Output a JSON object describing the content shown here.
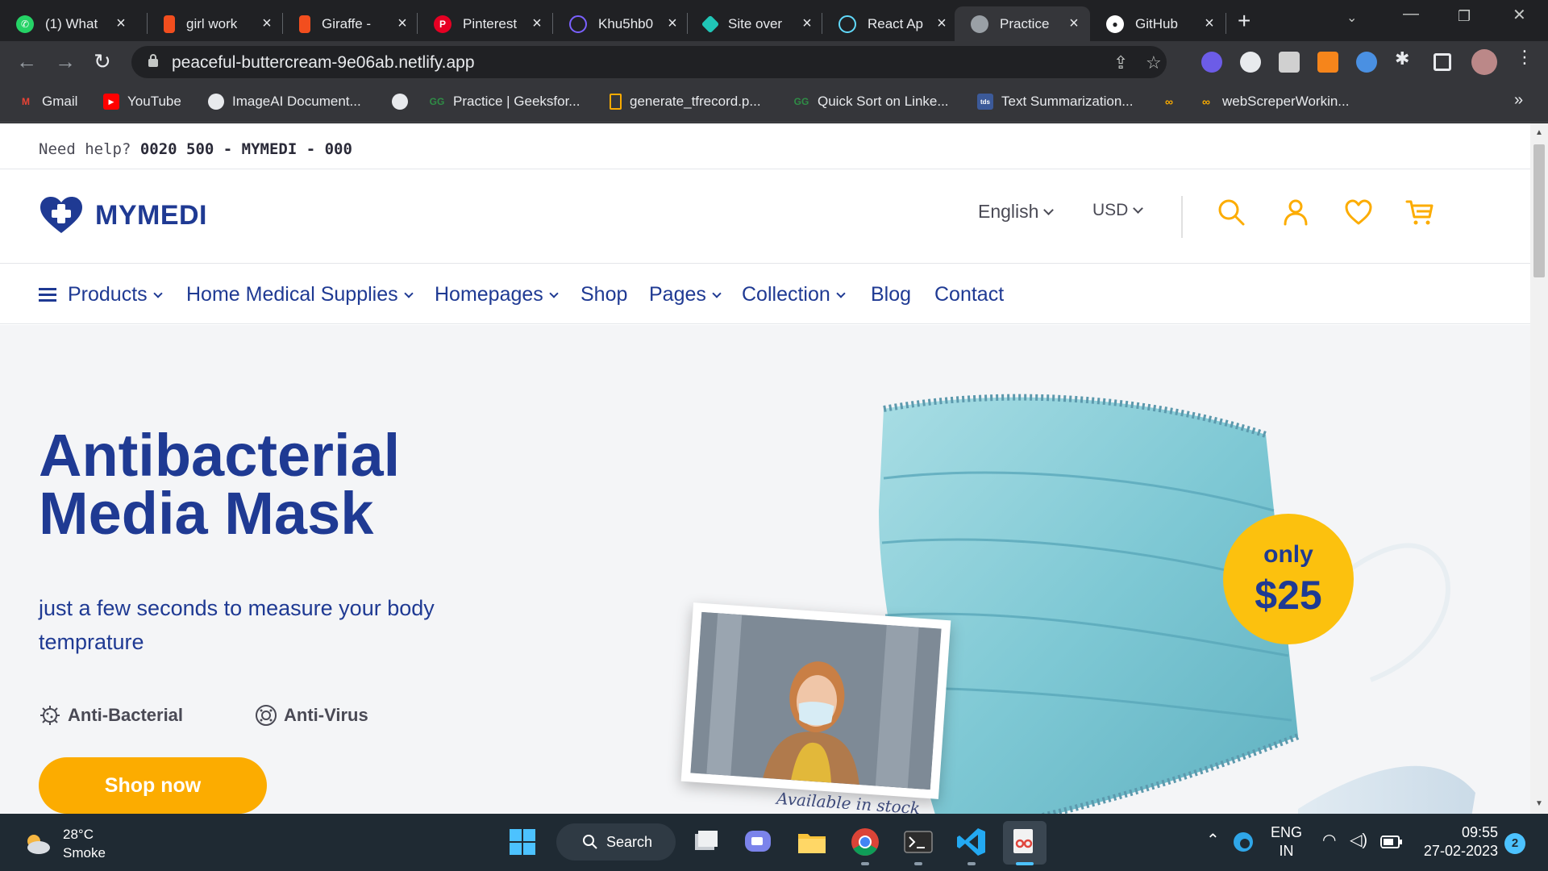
{
  "browser": {
    "tabs": [
      {
        "label": "(1) What",
        "icon": "whatsapp-icon",
        "color": "#25d366"
      },
      {
        "label": "girl work",
        "icon": "figma-icon",
        "color": "#f24e1e"
      },
      {
        "label": "Giraffe -",
        "icon": "figma-icon",
        "color": "#f24e1e"
      },
      {
        "label": "Pinterest",
        "icon": "pinterest-icon",
        "color": "#e60023"
      },
      {
        "label": "Khu5hb0",
        "icon": "web-icon",
        "color": "#7b61ff"
      },
      {
        "label": "Site over",
        "icon": "netlify-icon",
        "color": "#20c6b7"
      },
      {
        "label": "React Ap",
        "icon": "react-icon",
        "color": "#61dafb"
      },
      {
        "label": "Practice",
        "icon": "globe-icon",
        "color": "#9aa0a6"
      },
      {
        "label": "GitHub",
        "icon": "github-icon",
        "color": "#ffffff"
      }
    ],
    "url": "peaceful-buttercream-9e06ab.netlify.app",
    "bookmarks": [
      {
        "label": "Gmail",
        "icon": "gmail-icon"
      },
      {
        "label": "YouTube",
        "icon": "youtube-icon"
      },
      {
        "label": "ImageAI Document...",
        "icon": "globe-icon"
      },
      {
        "label": "",
        "icon": "globe-icon"
      },
      {
        "label": "Practice | Geeksfor...",
        "icon": "geeksforgeeks-icon"
      },
      {
        "label": "generate_tfrecord.p...",
        "icon": "file-icon"
      },
      {
        "label": "Quick Sort on Linke...",
        "icon": "geeksforgeeks-icon"
      },
      {
        "label": "Text Summarization...",
        "icon": "tds-icon"
      },
      {
        "label": "",
        "icon": "codeanywhere-icon"
      },
      {
        "label": "webScreperWorkin...",
        "icon": "codeanywhere-icon"
      }
    ],
    "more_bookmarks": "»"
  },
  "site": {
    "help_label": "Need help?",
    "help_phone": "0020 500 - MYMEDI - 000",
    "logo_text": "MYMEDI",
    "language": "English",
    "currency": "USD",
    "nav": [
      {
        "label": "Products",
        "dropdown": true
      },
      {
        "label": "Home Medical Supplies",
        "dropdown": true
      },
      {
        "label": "Homepages",
        "dropdown": true
      },
      {
        "label": "Shop",
        "dropdown": false
      },
      {
        "label": "Pages",
        "dropdown": true
      },
      {
        "label": "Collection",
        "dropdown": true
      },
      {
        "label": "Blog",
        "dropdown": false
      },
      {
        "label": "Contact",
        "dropdown": false
      }
    ],
    "hero": {
      "title_line1": "Antibacterial",
      "title_line2": "Media Mask",
      "subtitle": "just a few seconds to measure your body temprature",
      "feature1": "Anti-Bacterial",
      "feature2": "Anti-Virus",
      "cta": "Shop now",
      "badge_top": "only",
      "badge_price": "$25",
      "caption": "Available in stock"
    },
    "colors": {
      "brand": "#1f3a93",
      "accent": "#fcac00",
      "badge": "#fcc10e"
    }
  },
  "taskbar": {
    "temperature": "28°C",
    "weather": "Smoke",
    "search_label": "Search",
    "lang_top": "ENG",
    "lang_bottom": "IN",
    "time": "09:55",
    "date": "27-02-2023",
    "notifications": "2"
  }
}
